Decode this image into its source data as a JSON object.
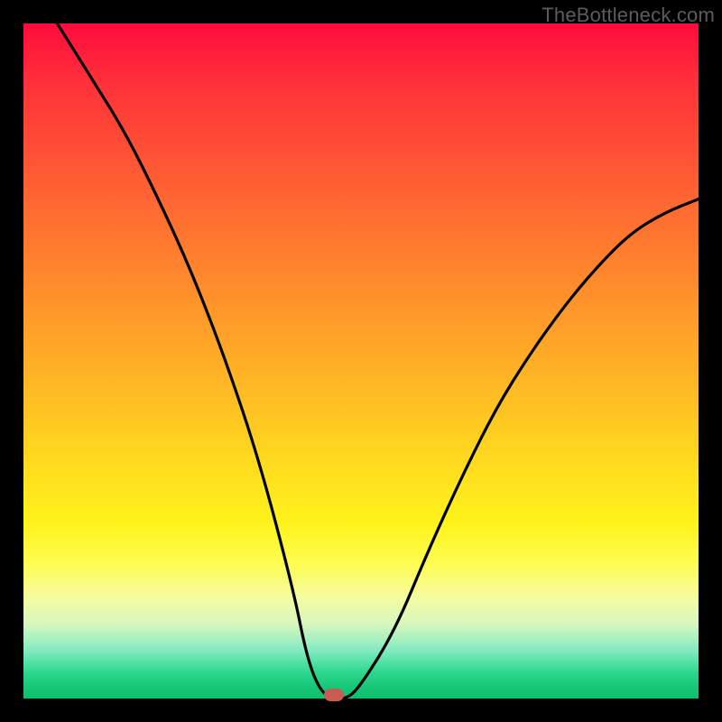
{
  "watermark": "TheBottleneck.com",
  "chart_data": {
    "type": "line",
    "title": "",
    "xlabel": "",
    "ylabel": "",
    "xlim": [
      0,
      100
    ],
    "ylim": [
      0,
      100
    ],
    "background_gradient_stops": [
      {
        "pos": 0,
        "color": "#ff0b3c"
      },
      {
        "pos": 50,
        "color": "#ffb325"
      },
      {
        "pos": 75,
        "color": "#fff31c"
      },
      {
        "pos": 100,
        "color": "#0fbf6c"
      }
    ],
    "series": [
      {
        "name": "bottleneck-curve",
        "x": [
          5,
          10,
          15,
          20,
          25,
          30,
          35,
          40,
          42,
          44,
          46,
          48,
          50,
          55,
          60,
          65,
          70,
          75,
          80,
          85,
          90,
          95,
          100
        ],
        "y": [
          100,
          92,
          84,
          74,
          63,
          50,
          35,
          16,
          6,
          1,
          0,
          0,
          2,
          10,
          22,
          33,
          43,
          51,
          58,
          64,
          69,
          72,
          74
        ]
      }
    ],
    "optimal_marker": {
      "x": 46,
      "y": 0
    },
    "colors": {
      "curve": "#000000",
      "marker": "#c95a54",
      "frame": "#000000"
    }
  }
}
